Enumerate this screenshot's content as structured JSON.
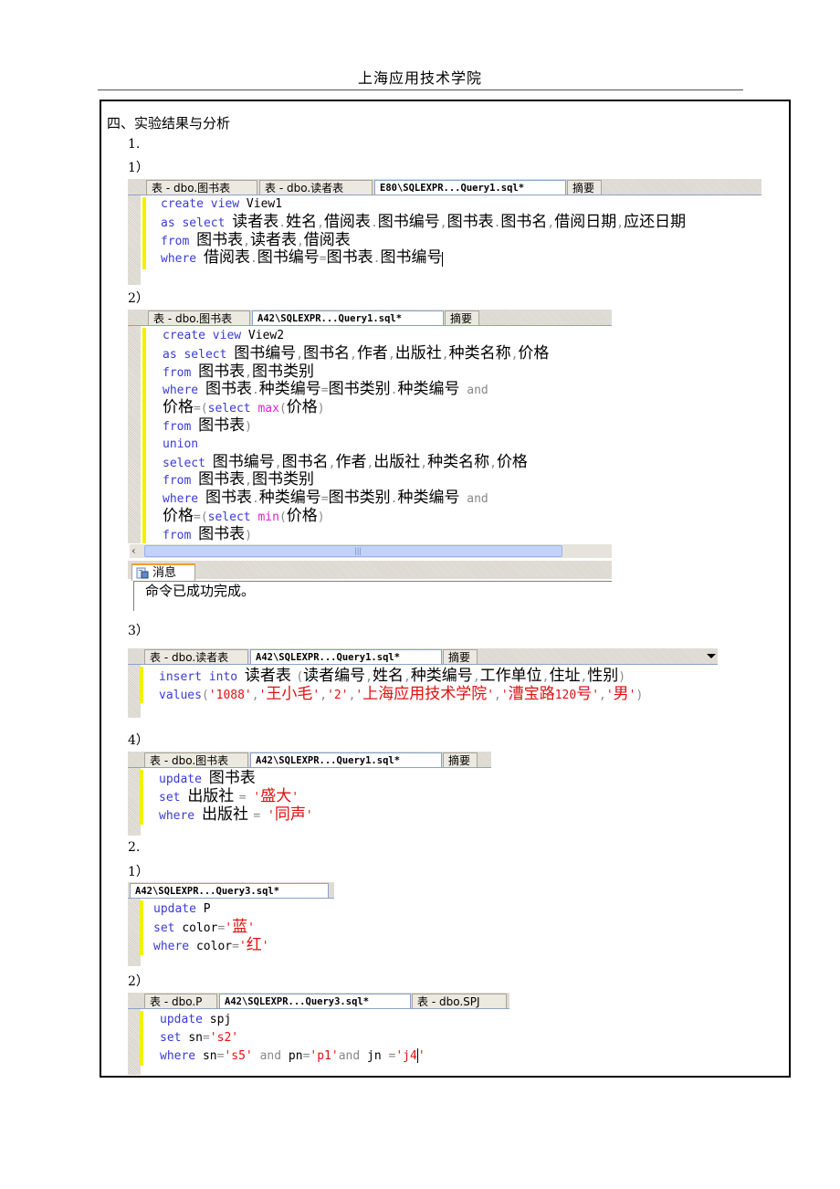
{
  "header": {
    "title": "上海应用技术学院"
  },
  "section": {
    "title": "四、实验结果与分析"
  },
  "labels": {
    "part1": "1.",
    "p1_1": "1）",
    "p1_2": "2）",
    "p1_3": "3）",
    "p1_4": "4）",
    "part2": "2.",
    "p2_1": "1）",
    "p2_2": "2）"
  },
  "editors": [
    {
      "tabs": [
        "表 - dbo.图书表",
        "表 - dbo.读者表",
        "E80\\SQLEXPR...Query1.sql*",
        "摘要"
      ],
      "active_tab": 2,
      "lines": [
        [
          [
            "kw",
            "create view "
          ],
          [
            "plain",
            "View1"
          ]
        ],
        [
          [
            "kw",
            "as select "
          ],
          [
            "cn",
            "读者表"
          ],
          [
            "op",
            "."
          ],
          [
            "cn",
            "姓名"
          ],
          [
            "op",
            ","
          ],
          [
            "cn",
            "借阅表"
          ],
          [
            "op",
            "."
          ],
          [
            "cn",
            "图书编号"
          ],
          [
            "op",
            ","
          ],
          [
            "cn",
            "图书表"
          ],
          [
            "op",
            "."
          ],
          [
            "cn",
            "图书名"
          ],
          [
            "op",
            ","
          ],
          [
            "cn",
            "借阅日期"
          ],
          [
            "op",
            ","
          ],
          [
            "cn",
            "应还日期"
          ]
        ],
        [
          [
            "kw",
            "from "
          ],
          [
            "cn",
            "图书表"
          ],
          [
            "op",
            ","
          ],
          [
            "cn",
            "读者表"
          ],
          [
            "op",
            ","
          ],
          [
            "cn",
            "借阅表"
          ]
        ],
        [
          [
            "kw",
            "where "
          ],
          [
            "cn",
            "借阅表"
          ],
          [
            "op",
            "."
          ],
          [
            "cn",
            "图书编号"
          ],
          [
            "op",
            "="
          ],
          [
            "cn",
            "图书表"
          ],
          [
            "op",
            "."
          ],
          [
            "cn",
            "图书编号"
          ],
          [
            "caret",
            ""
          ]
        ]
      ]
    },
    {
      "tabs": [
        "表 - dbo.图书表",
        "A42\\SQLEXPR...Query1.sql*",
        "摘要"
      ],
      "active_tab": 1,
      "lines": [
        [
          [
            "kw",
            "create view "
          ],
          [
            "plain",
            "View2"
          ]
        ],
        [
          [
            "kw",
            "as select "
          ],
          [
            "cn",
            "图书编号"
          ],
          [
            "op",
            ","
          ],
          [
            "cn",
            "图书名"
          ],
          [
            "op",
            ","
          ],
          [
            "cn",
            "作者"
          ],
          [
            "op",
            ","
          ],
          [
            "cn",
            "出版社"
          ],
          [
            "op",
            ","
          ],
          [
            "cn",
            "种类名称"
          ],
          [
            "op",
            ","
          ],
          [
            "cn",
            "价格"
          ]
        ],
        [
          [
            "kw",
            "from "
          ],
          [
            "cn",
            "图书表"
          ],
          [
            "op",
            ","
          ],
          [
            "cn",
            "图书类别"
          ]
        ],
        [
          [
            "kw",
            "where "
          ],
          [
            "cn",
            "图书表"
          ],
          [
            "op",
            "."
          ],
          [
            "cn",
            "种类编号"
          ],
          [
            "op",
            "="
          ],
          [
            "cn",
            "图书类别"
          ],
          [
            "op",
            "."
          ],
          [
            "cn",
            "种类编号"
          ],
          [
            "op",
            " and"
          ]
        ],
        [
          [
            "cn",
            "价格"
          ],
          [
            "op",
            "=("
          ],
          [
            "kw",
            "select "
          ],
          [
            "fn",
            "max"
          ],
          [
            "op",
            "("
          ],
          [
            "cn",
            "价格"
          ],
          [
            "op",
            ")"
          ]
        ],
        [
          [
            "kw",
            "from "
          ],
          [
            "cn",
            "图书表"
          ],
          [
            "op",
            ")"
          ]
        ],
        [
          [
            "kw",
            "union"
          ]
        ],
        [
          [
            "kw",
            "select "
          ],
          [
            "cn",
            "图书编号"
          ],
          [
            "op",
            ","
          ],
          [
            "cn",
            "图书名"
          ],
          [
            "op",
            ","
          ],
          [
            "cn",
            "作者"
          ],
          [
            "op",
            ","
          ],
          [
            "cn",
            "出版社"
          ],
          [
            "op",
            ","
          ],
          [
            "cn",
            "种类名称"
          ],
          [
            "op",
            ","
          ],
          [
            "cn",
            "价格"
          ]
        ],
        [
          [
            "kw",
            "from "
          ],
          [
            "cn",
            "图书表"
          ],
          [
            "op",
            ","
          ],
          [
            "cn",
            "图书类别"
          ]
        ],
        [
          [
            "kw",
            "where "
          ],
          [
            "cn",
            "图书表"
          ],
          [
            "op",
            "."
          ],
          [
            "cn",
            "种类编号"
          ],
          [
            "op",
            "="
          ],
          [
            "cn",
            "图书类别"
          ],
          [
            "op",
            "."
          ],
          [
            "cn",
            "种类编号"
          ],
          [
            "op",
            " and"
          ]
        ],
        [
          [
            "cn",
            "价格"
          ],
          [
            "op",
            "=("
          ],
          [
            "kw",
            "select "
          ],
          [
            "fn",
            "min"
          ],
          [
            "op",
            "("
          ],
          [
            "cn",
            "价格"
          ],
          [
            "op",
            ")"
          ]
        ],
        [
          [
            "kw",
            "from "
          ],
          [
            "cn",
            "图书表"
          ],
          [
            "op",
            ")"
          ]
        ]
      ],
      "messages_tab": "消息",
      "message": "命令已成功完成。"
    },
    {
      "tabs": [
        "表 - dbo.读者表",
        "A42\\SQLEXPR...Query1.sql*",
        "摘要"
      ],
      "active_tab": 1,
      "lines": [
        [
          [
            "kw",
            "insert into "
          ],
          [
            "cn",
            "读者表 "
          ],
          [
            "op",
            "("
          ],
          [
            "cn",
            "读者编号"
          ],
          [
            "op",
            ","
          ],
          [
            "cn",
            "姓名"
          ],
          [
            "op",
            ","
          ],
          [
            "cn",
            "种类编号"
          ],
          [
            "op",
            ","
          ],
          [
            "cn",
            "工作单位"
          ],
          [
            "op",
            ","
          ],
          [
            "cn",
            "住址"
          ],
          [
            "op",
            ","
          ],
          [
            "cn",
            "性别"
          ],
          [
            "op",
            ")"
          ]
        ],
        [
          [
            "kw",
            "values"
          ],
          [
            "op",
            "("
          ],
          [
            "str",
            "'1088'"
          ],
          [
            "op",
            ","
          ],
          [
            "str",
            "'"
          ],
          [
            "cnstr",
            "王小毛"
          ],
          [
            "str",
            "'"
          ],
          [
            "op",
            ","
          ],
          [
            "str",
            "'2'"
          ],
          [
            "op",
            ","
          ],
          [
            "str",
            "'"
          ],
          [
            "cnstr",
            "上海应用技术学院"
          ],
          [
            "str",
            "'"
          ],
          [
            "op",
            ","
          ],
          [
            "str",
            "'"
          ],
          [
            "cnstr",
            "漕宝路"
          ],
          [
            "str",
            "120"
          ],
          [
            "cnstr",
            "号"
          ],
          [
            "str",
            "'"
          ],
          [
            "op",
            ","
          ],
          [
            "str",
            "'"
          ],
          [
            "cnstr",
            "男"
          ],
          [
            "str",
            "'"
          ],
          [
            "op",
            ")"
          ]
        ]
      ]
    },
    {
      "tabs": [
        "表 - dbo.图书表",
        "A42\\SQLEXPR...Query1.sql*",
        "摘要"
      ],
      "active_tab": 1,
      "lines": [
        [
          [
            "kw",
            "update "
          ],
          [
            "cn",
            "图书表"
          ]
        ],
        [
          [
            "kw",
            "set "
          ],
          [
            "cn",
            "出版社 "
          ],
          [
            "op",
            "= "
          ],
          [
            "str",
            "'"
          ],
          [
            "cnstr",
            "盛大"
          ],
          [
            "str",
            "'"
          ]
        ],
        [
          [
            "kw",
            "where "
          ],
          [
            "cn",
            "出版社 "
          ],
          [
            "op",
            "= "
          ],
          [
            "str",
            "'"
          ],
          [
            "cnstr",
            "同声"
          ],
          [
            "str",
            "'"
          ]
        ]
      ]
    },
    {
      "tabs": [
        "A42\\SQLEXPR...Query3.sql*"
      ],
      "active_tab": 0,
      "lines": [
        [
          [
            "kw",
            "update "
          ],
          [
            "plain",
            "P"
          ]
        ],
        [
          [
            "kw",
            "set "
          ],
          [
            "plain",
            "color"
          ],
          [
            "op",
            "="
          ],
          [
            "str",
            "'"
          ],
          [
            "cnstr",
            "蓝"
          ],
          [
            "str",
            "'"
          ]
        ],
        [
          [
            "kw",
            "where "
          ],
          [
            "plain",
            "color"
          ],
          [
            "op",
            "="
          ],
          [
            "str",
            "'"
          ],
          [
            "cnstr",
            "红"
          ],
          [
            "str",
            "'"
          ]
        ]
      ]
    },
    {
      "tabs": [
        "表 - dbo.P",
        "A42\\SQLEXPR...Query3.sql*",
        "表 - dbo.SPJ"
      ],
      "active_tab": 1,
      "lines": [
        [
          [
            "kw",
            "update "
          ],
          [
            "plain",
            "spj"
          ]
        ],
        [
          [
            "kw",
            "set "
          ],
          [
            "plain",
            "sn"
          ],
          [
            "op",
            "="
          ],
          [
            "str",
            "'s2'"
          ]
        ],
        [
          [
            "kw",
            "where "
          ],
          [
            "plain",
            "sn"
          ],
          [
            "op",
            "="
          ],
          [
            "str",
            "'s5'"
          ],
          [
            "op",
            " and "
          ],
          [
            "plain",
            "pn"
          ],
          [
            "op",
            "="
          ],
          [
            "str",
            "'p1'"
          ],
          [
            "op",
            "and "
          ],
          [
            "plain",
            "jn "
          ],
          [
            "op",
            "="
          ],
          [
            "str",
            "'j4"
          ],
          [
            "caret",
            ""
          ],
          [
            "str",
            "'"
          ]
        ]
      ]
    }
  ]
}
